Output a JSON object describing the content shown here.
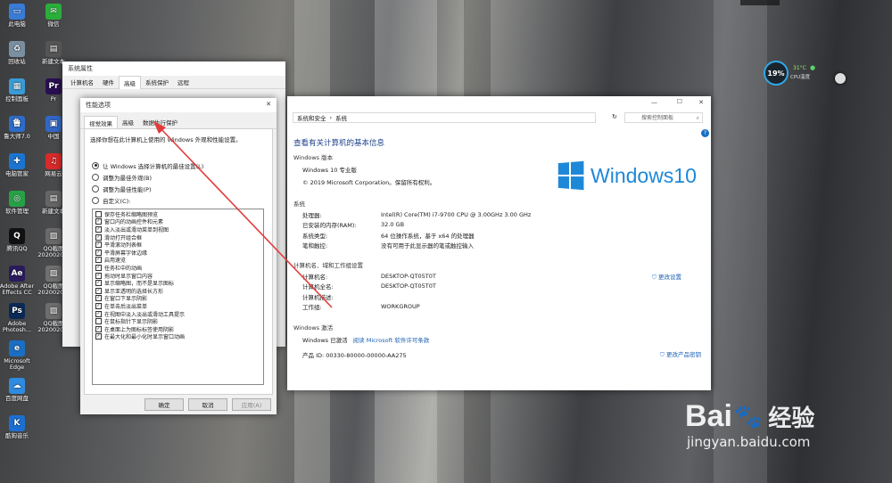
{
  "desktop_icons": [
    {
      "label": "此电脑",
      "color": "#3a7bd5",
      "glyph": "▭"
    },
    {
      "label": "回收站",
      "color": "#7a8fa0",
      "glyph": "♻"
    },
    {
      "label": "控制面板",
      "color": "#3a9bd5",
      "glyph": "▦"
    },
    {
      "label": "鲁大师7.0",
      "color": "#2d6cc8",
      "glyph": "鲁"
    },
    {
      "label": "电脑管家",
      "color": "#1b75d0",
      "glyph": "✚"
    },
    {
      "label": "软件管理",
      "color": "#27a146",
      "glyph": "◎"
    },
    {
      "label": "腾讯QQ",
      "color": "#111111",
      "glyph": "Q"
    },
    {
      "label": "Adobe After Effects CC",
      "color": "#2b1b5c",
      "glyph": "Ae"
    },
    {
      "label": "Adobe Photosh...",
      "color": "#0a2a55",
      "glyph": "Ps"
    },
    {
      "label": "Microsoft Edge",
      "color": "#1a6fc4",
      "glyph": "e"
    },
    {
      "label": "百度网盘",
      "color": "#2f8be0",
      "glyph": "☁"
    },
    {
      "label": "酷狗音乐",
      "color": "#1c6fd1",
      "glyph": "K"
    }
  ],
  "desktop_icons_col2": [
    {
      "label": "微信",
      "color": "#2aae3a",
      "glyph": "✉"
    },
    {
      "label": "新建文本",
      "color": "#555555",
      "glyph": "▤"
    },
    {
      "label": "Pr",
      "color": "#2a0e52",
      "glyph": "Pr"
    },
    {
      "label": "中国",
      "color": "#3367c7",
      "glyph": "▣"
    },
    {
      "label": "网易云",
      "color": "#d82a2a",
      "glyph": "♫"
    },
    {
      "label": "新建文本",
      "color": "#666666",
      "glyph": "▤"
    },
    {
      "label": "QQ截图 2020020...",
      "color": "#6a6a6a",
      "glyph": "▨"
    },
    {
      "label": "QQ截图 2020020...",
      "color": "#707070",
      "glyph": "▨"
    },
    {
      "label": "QQ截图 2020020...",
      "color": "#6e6e6e",
      "glyph": "▨"
    }
  ],
  "widget": {
    "percent": "19%",
    "temp": "31°C",
    "temp_label": "CPU温度"
  },
  "sysprops": {
    "title": "系统属性",
    "tabs": [
      "计算机名",
      "硬件",
      "高级",
      "系统保护",
      "远程"
    ],
    "active_tab": 2
  },
  "perf": {
    "title": "性能选项",
    "close": "✕",
    "tabs": [
      "视觉效果",
      "高级",
      "数据执行保护"
    ],
    "active_tab": 0,
    "intro": "选择你想在此计算机上使用的 Windows 外观和性能设置。",
    "radios": [
      {
        "label": "让 Windows 选择计算机的最佳设置(L)",
        "on": true
      },
      {
        "label": "调整为最佳外观(B)",
        "on": false
      },
      {
        "label": "调整为最佳性能(P)",
        "on": false
      },
      {
        "label": "自定义(C):",
        "on": false
      }
    ],
    "checks": [
      {
        "label": "保存任务栏缩略图预览",
        "on": false
      },
      {
        "label": "窗口内的动画控件和元素",
        "on": true
      },
      {
        "label": "淡入淡出或滑动菜单到视图",
        "on": true
      },
      {
        "label": "滑动打开组合框",
        "on": true
      },
      {
        "label": "平滑滚动列表框",
        "on": true
      },
      {
        "label": "平滑屏幕字体边缘",
        "on": true
      },
      {
        "label": "启用速览",
        "on": true
      },
      {
        "label": "任务栏中的动画",
        "on": true
      },
      {
        "label": "拖动时显示窗口内容",
        "on": true
      },
      {
        "label": "显示缩略图，而不是显示图标",
        "on": true
      },
      {
        "label": "显示亚透明的选择长方形",
        "on": true
      },
      {
        "label": "在窗口下显示阴影",
        "on": true
      },
      {
        "label": "在单击后淡出菜单",
        "on": true
      },
      {
        "label": "在视图中淡入淡出或滑动工具提示",
        "on": true
      },
      {
        "label": "在鼠标指针下显示阴影",
        "on": false
      },
      {
        "label": "在桌面上为图标标签使用阴影",
        "on": true
      },
      {
        "label": "在最大化和最小化时显示窗口动画",
        "on": true
      }
    ],
    "check_mark": "✓",
    "ok": "确定",
    "cancel": "取消",
    "apply": "应用(A)"
  },
  "system": {
    "min": "—",
    "max": "☐",
    "close": "✕",
    "breadcrumb": [
      "系统和安全",
      "系统"
    ],
    "search_placeholder": "搜索控制面板",
    "heading": "查看有关计算机的基本信息",
    "edition_header": "Windows 版本",
    "edition": "Windows 10 专业版",
    "copyright": "© 2019 Microsoft Corporation。保留所有权利。",
    "logo_text": "Windows10",
    "system_header": "系统",
    "system_rows": [
      {
        "k": "处理器:",
        "v": "Intel(R) Core(TM) i7-9700 CPU @ 3.00GHz   3.00 GHz"
      },
      {
        "k": "已安装的内存(RAM):",
        "v": "32.0 GB"
      },
      {
        "k": "系统类型:",
        "v": "64 位操作系统，基于 x64 的处理器"
      },
      {
        "k": "笔和触控:",
        "v": "没有可用于此显示器的笔或触控输入"
      }
    ],
    "name_header": "计算机名、域和工作组设置",
    "name_rows": [
      {
        "k": "计算机名:",
        "v": "DESKTOP-QT05T0T"
      },
      {
        "k": "计算机全名:",
        "v": "DESKTOP-QT05T0T"
      },
      {
        "k": "计算机描述:",
        "v": ""
      },
      {
        "k": "工作组:",
        "v": "WORKGROUP"
      }
    ],
    "change_settings": "更改设置",
    "activation_header": "Windows 激活",
    "activated": "Windows 已激活",
    "license_link": "阅读 Microsoft 软件许可条款",
    "product_id": "产品 ID: 00330-80000-00000-AA275",
    "change_key": "更改产品密钥",
    "help": "?"
  },
  "watermark": {
    "main": "Bai",
    "paw": "du",
    "sub": "经验",
    "url": "jingyan.baidu.com"
  }
}
